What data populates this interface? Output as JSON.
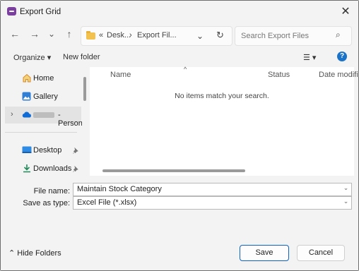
{
  "window": {
    "title": "Export Grid",
    "close_glyph": "✕"
  },
  "nav": {
    "back": "←",
    "forward": "→",
    "recent": "⌄",
    "up": "↑",
    "address": {
      "sep1": "«",
      "crumb1": "Desk...",
      "sep2": "›",
      "crumb2": "Export Fil...",
      "dropdown": "⌄",
      "refresh": "↻"
    },
    "search": {
      "placeholder": "Search Export Files",
      "icon": "⌕"
    }
  },
  "toolbar": {
    "organize": "Organize ▾",
    "new_folder": "New folder",
    "view": "☰ ▾",
    "help": "?"
  },
  "sidebar": {
    "items": [
      {
        "label": "Home",
        "icon": "home-icon"
      },
      {
        "label": "Gallery",
        "icon": "gallery-icon"
      },
      {
        "label": "- Person",
        "icon": "onedrive-icon",
        "expand": "›"
      },
      {
        "label": "Desktop",
        "icon": "desktop-icon",
        "pin": "📌"
      },
      {
        "label": "Downloads",
        "icon": "downloads-icon",
        "pin": "📌"
      }
    ]
  },
  "content": {
    "columns": [
      "Name",
      "Status",
      "Date modifi"
    ],
    "sort_glyph": "^",
    "empty_message": "No items match your search."
  },
  "form": {
    "file_name_label": "File name:",
    "file_name_value": "Maintain Stock Category",
    "save_as_label": "Save as type:",
    "save_as_value": "Excel File (*.xlsx)"
  },
  "footer": {
    "hide_folders": "⌃ Hide Folders",
    "save": "Save",
    "cancel": "Cancel"
  },
  "colors": {
    "accent": "#0b62c4",
    "app_icon": "#7b3fa0",
    "folder": "#f2c14e"
  }
}
